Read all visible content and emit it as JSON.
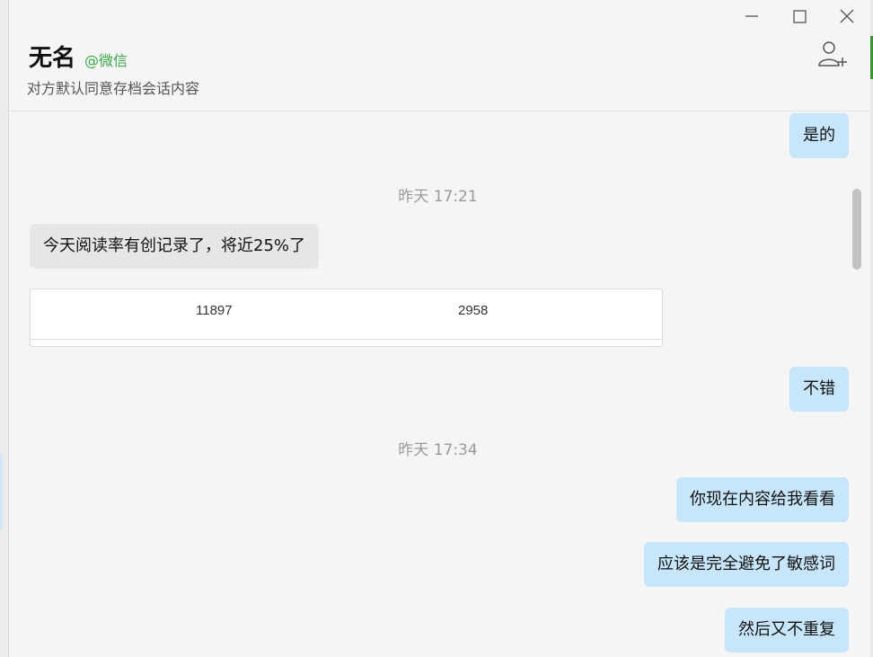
{
  "window": {
    "controls": [
      "minimize-icon",
      "maximize-icon",
      "close-icon"
    ]
  },
  "header": {
    "contact_name": "无名",
    "source_tag": "@微信",
    "subtitle": "对方默认同意存档会话内容",
    "add_member_icon": "add-person-icon"
  },
  "messages": [
    {
      "side": "right",
      "text": "是的"
    },
    {
      "type": "time",
      "text": "昨天 17:21"
    },
    {
      "side": "left",
      "text": "今天阅读率有创记录了，将近25%了"
    },
    {
      "type": "card",
      "values": [
        "11897",
        "2958"
      ]
    },
    {
      "side": "right",
      "text": "不错"
    },
    {
      "type": "time",
      "text": "昨天 17:34"
    },
    {
      "side": "right",
      "text": "你现在内容给我看看"
    },
    {
      "side": "right",
      "text": "应该是完全避免了敏感词"
    },
    {
      "side": "right",
      "text": "然后又不重复"
    }
  ],
  "colors": {
    "right_bubble": "#c8e6fa",
    "left_bubble": "#e6e6e6",
    "background": "#f5f5f5",
    "wechat_green": "#3aa84a"
  }
}
